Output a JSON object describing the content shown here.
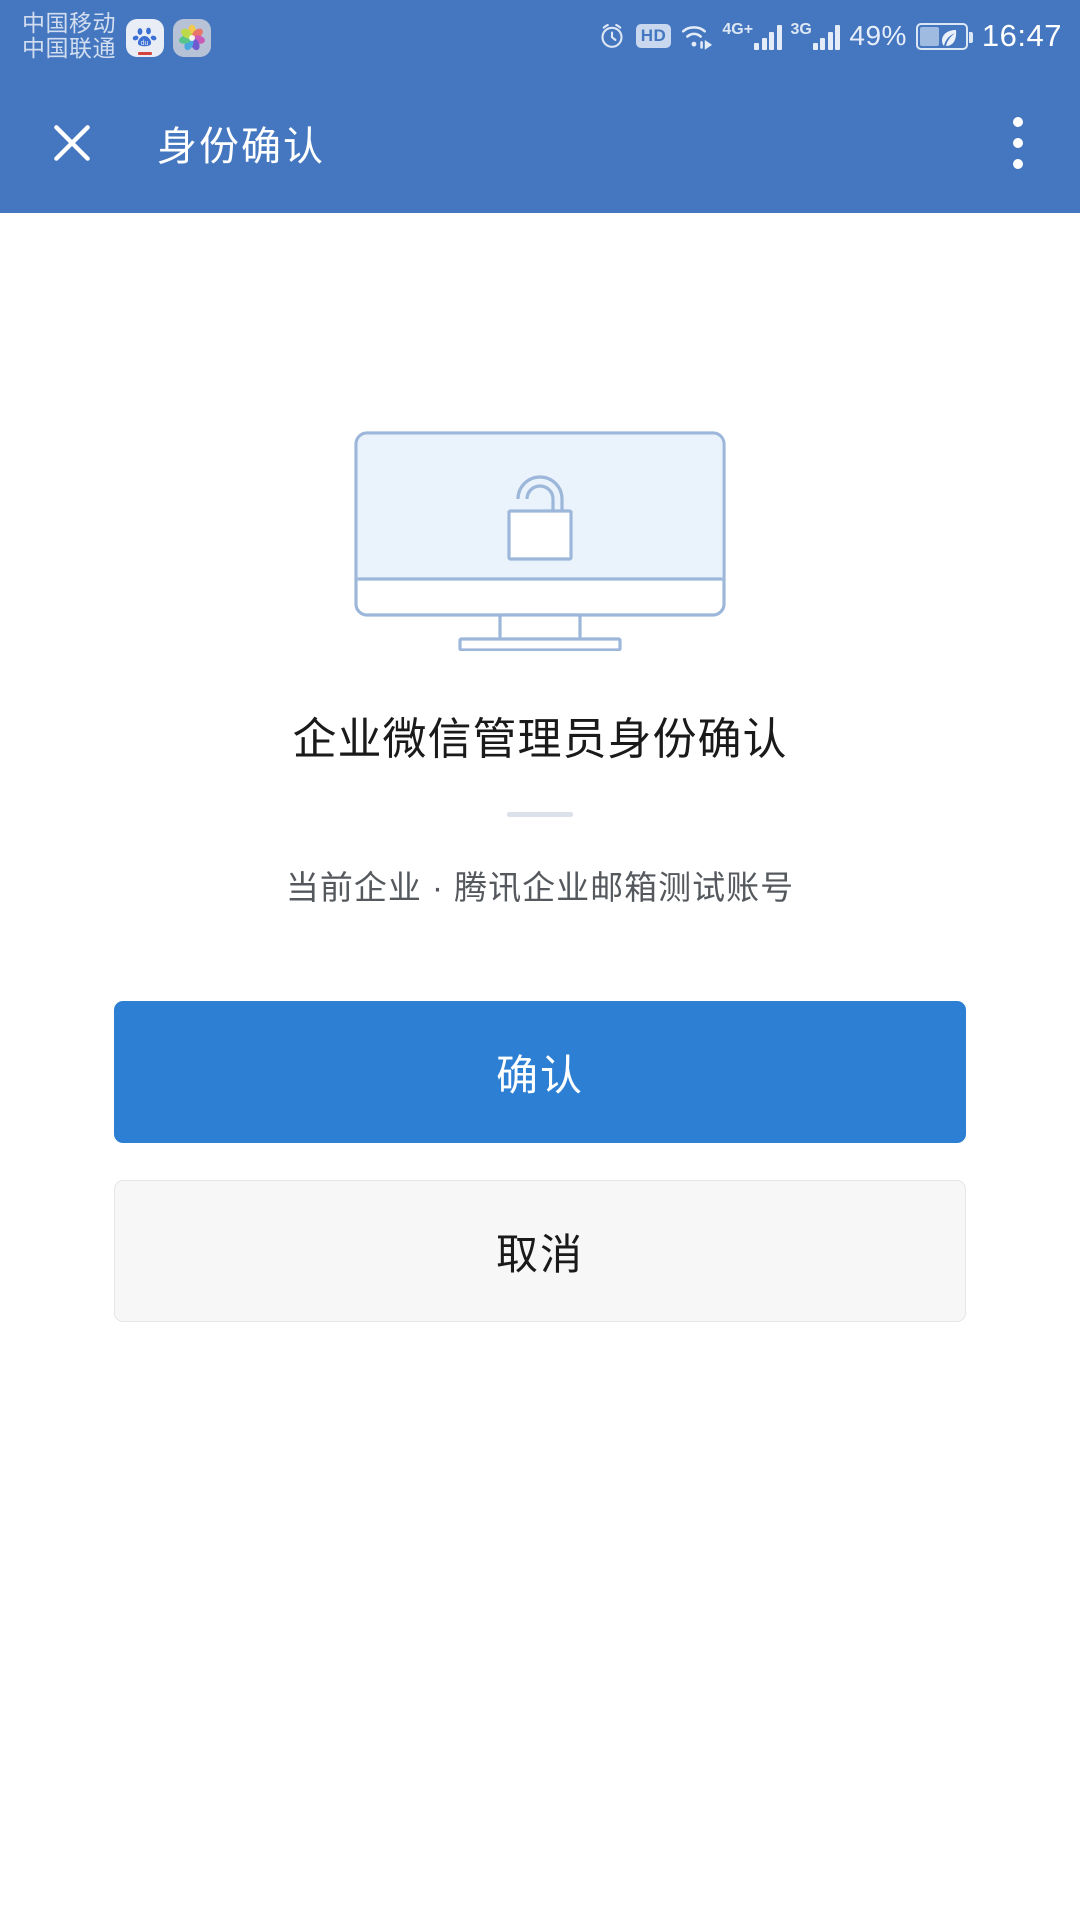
{
  "statusbar": {
    "carriers": [
      "中国移动",
      "中国联通"
    ],
    "notification_icons": [
      {
        "name": "baidu-app-icon",
        "label": "du"
      },
      {
        "name": "photos-app-icon",
        "label": ""
      }
    ],
    "alarm_icon": "alarm-clock-icon",
    "hd_label": "HD",
    "wifi_icon": "wifi-icon",
    "network_1_label": "4G+",
    "network_2_label": "3G",
    "battery_percent": "49%",
    "battery_icon": "battery-power-saving-icon",
    "time": "16:47"
  },
  "appbar": {
    "close_icon": "close-icon",
    "title": "身份确认",
    "overflow_icon": "more-vertical-icon"
  },
  "main": {
    "illustration": "monitor-with-lock-illustration",
    "title": "企业微信管理员身份确认",
    "subtitle": "当前企业 · 腾讯企业邮箱测试账号",
    "confirm_label": "确认",
    "cancel_label": "取消"
  },
  "colors": {
    "header_blue": "#4477bf",
    "primary_button_blue": "#2d7fd3",
    "secondary_button_gray": "#f7f7f7",
    "illustration_outline": "#9cb7da",
    "illustration_screen": "#eaf3fc",
    "divider_gray": "#dde2ea"
  }
}
